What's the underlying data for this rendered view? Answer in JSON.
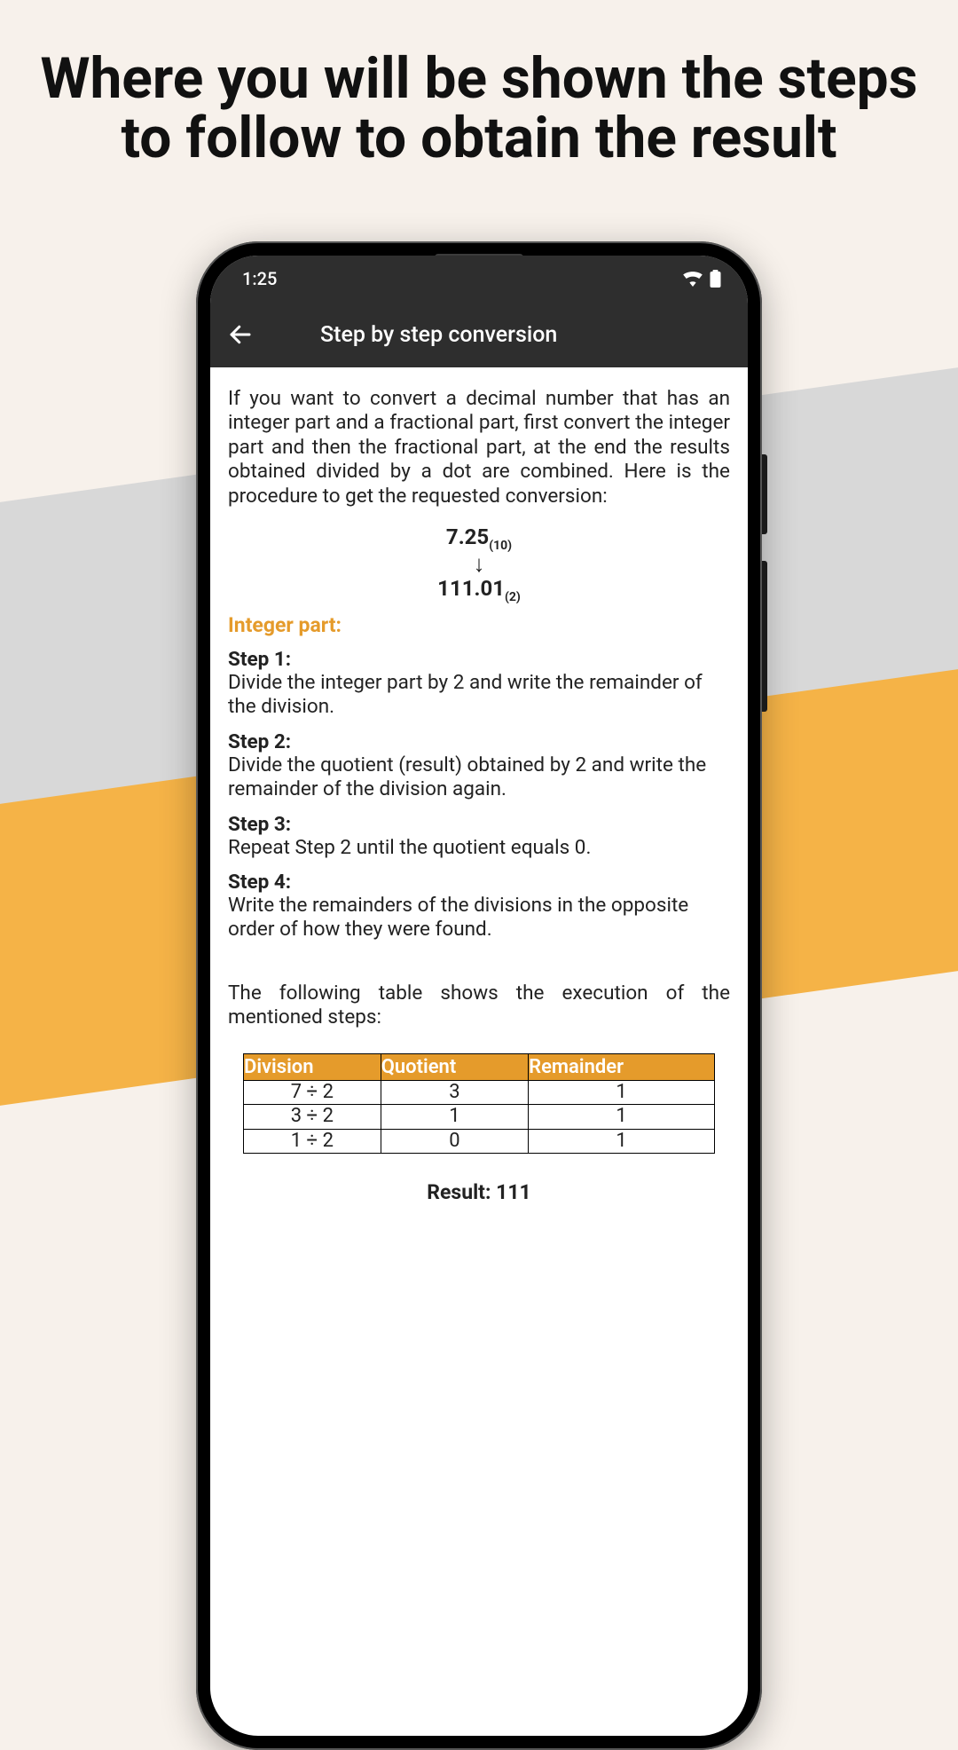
{
  "headline": "Where you will be shown the steps to follow to obtain the result",
  "status": {
    "time": "1:25"
  },
  "appbar": {
    "title": "Step by step conversion"
  },
  "intro": "If you want to convert a decimal number that has an integer part and a fractional part, first convert the integer part and then the fractional part, at the end the results obtained divided by a dot are combined. Here is the procedure to get the requested conversion:",
  "conversion": {
    "from_value": "7.25",
    "from_base": "(10)",
    "to_value": "111.01",
    "to_base": "(2)"
  },
  "section_integer": "Integer part:",
  "steps": [
    {
      "label": "Step 1:",
      "text": "Divide the integer part by 2 and write the remainder of the division."
    },
    {
      "label": "Step 2:",
      "text": "Divide the quotient (result) obtained by 2 and write the remainder of the division again."
    },
    {
      "label": "Step 3:",
      "text": "Repeat Step 2 until the quotient equals 0."
    },
    {
      "label": "Step 4:",
      "text": "Write the remainders of the divisions in the opposite order of how they were found."
    }
  ],
  "table_intro": "The following table shows the execution of the mentioned steps:",
  "table": {
    "headers": [
      "Division",
      "Quotient",
      "Remainder"
    ],
    "rows": [
      [
        "7 ÷ 2",
        "3",
        "1"
      ],
      [
        "3 ÷ 2",
        "1",
        "1"
      ],
      [
        "1 ÷ 2",
        "0",
        "1"
      ]
    ]
  },
  "result": "Result: 111"
}
